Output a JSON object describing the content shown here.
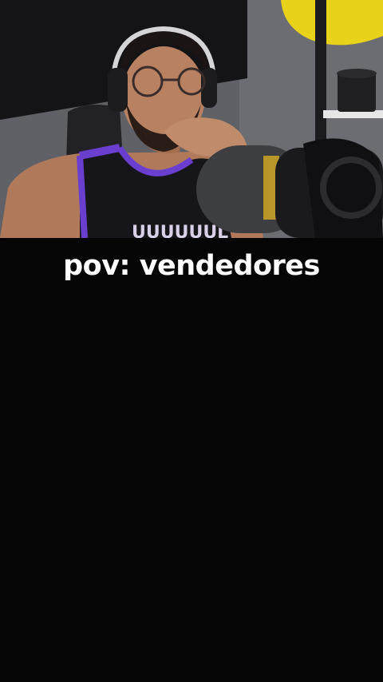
{
  "caption": {
    "text": "pov: vendedores",
    "color": "#ffffff"
  },
  "video": {
    "scene": "person-with-headphones-and-microphone"
  },
  "colors": {
    "background": "#050506",
    "jersey_trim": "#6a3fd0"
  }
}
